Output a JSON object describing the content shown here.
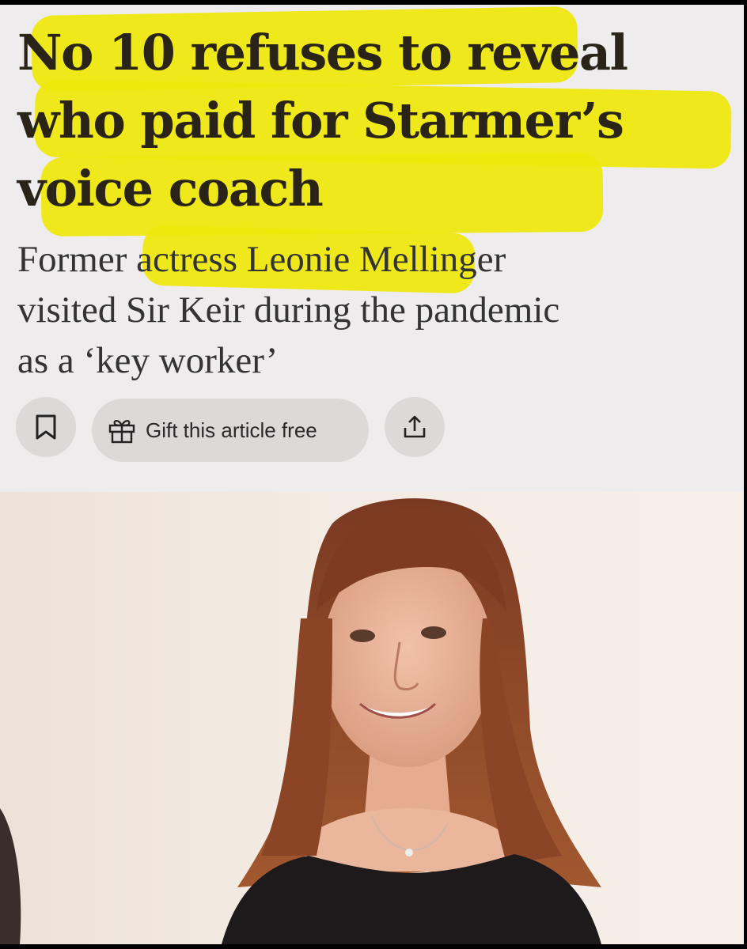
{
  "article": {
    "headline_lines": [
      "No 10 refuses to reveal",
      "who paid for Starmer’s",
      "voice coach"
    ],
    "standfirst_lines": [
      "Former actress Leonie Mellinger",
      "visited Sir Keir during the pandemic",
      "as a ‘key worker’"
    ]
  },
  "actions": {
    "bookmark_icon": "bookmark-icon",
    "gift_icon": "gift-icon",
    "gift_label": "Gift this article free",
    "share_icon": "share-icon"
  },
  "photo": {
    "subject": "photo-of-woman"
  },
  "colors": {
    "highlight": "#efe80a",
    "page_bg": "#eeecec",
    "button_bg": "#dcd9d9"
  }
}
